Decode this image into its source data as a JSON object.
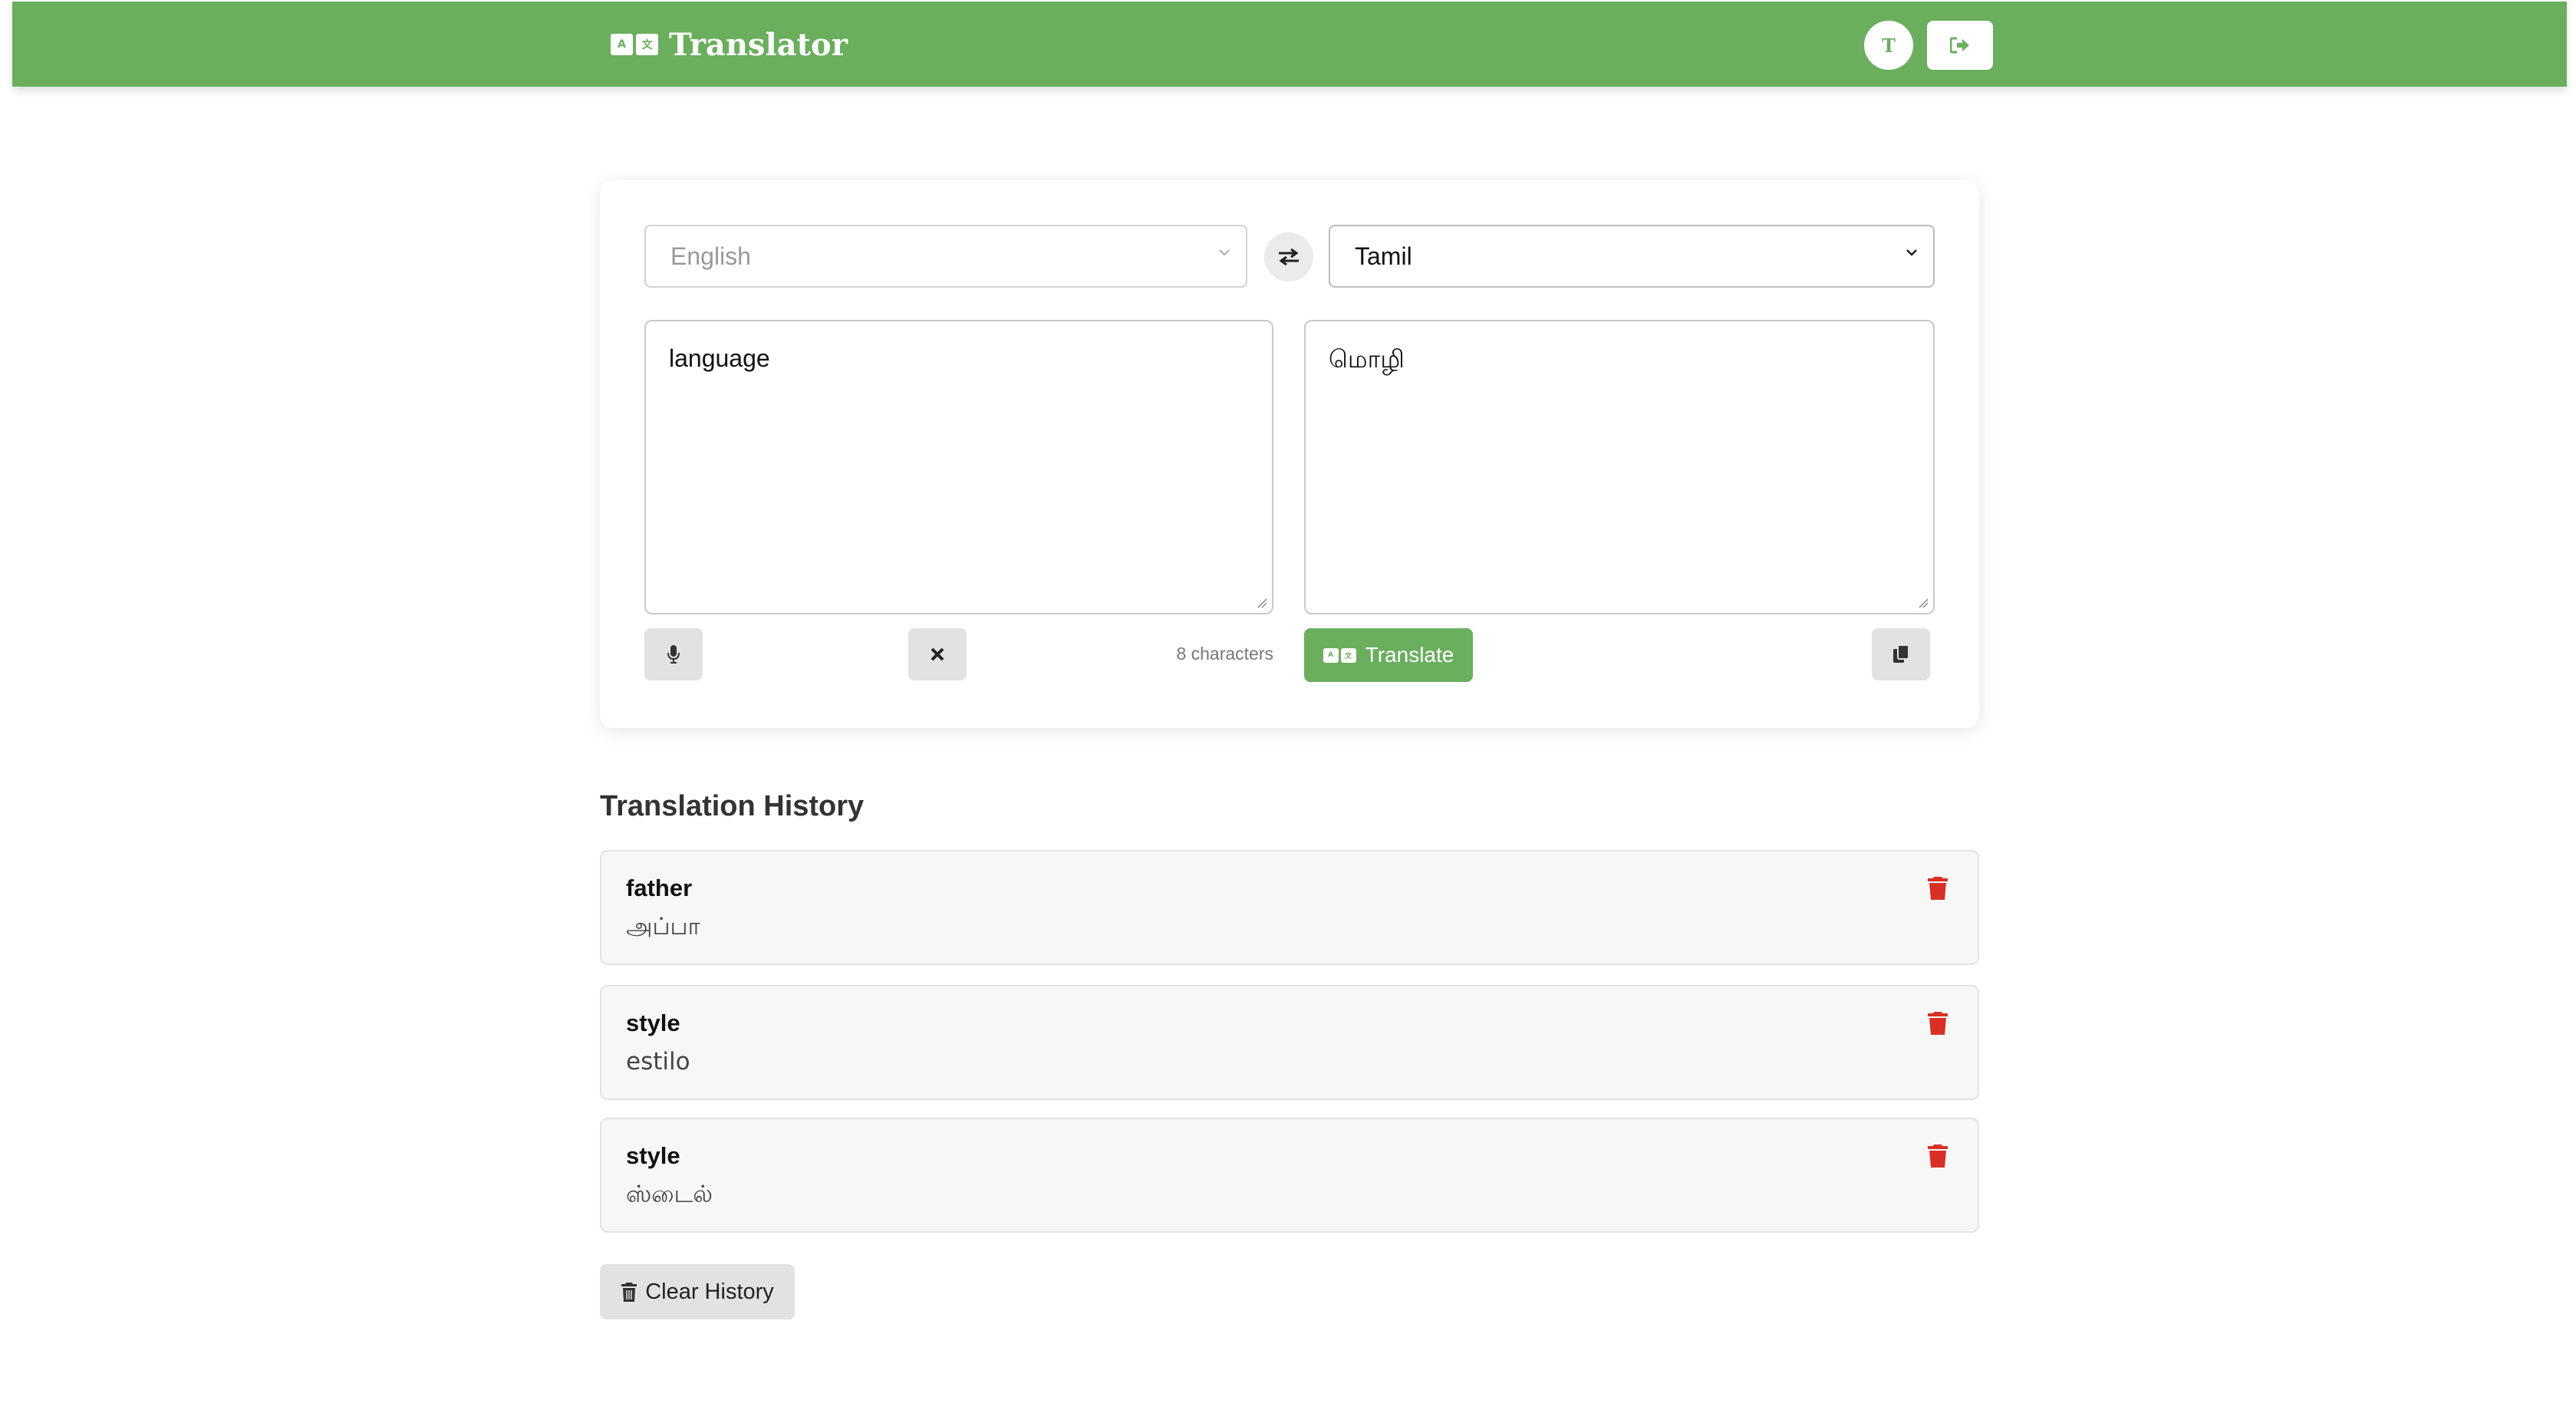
{
  "header": {
    "icon": "translate-icon",
    "title": "Translator",
    "avatar_initial": "T",
    "logout_icon": "sign-out-icon"
  },
  "translator": {
    "source_language": "English",
    "target_language": "Tamil",
    "swap_icon": "swap-arrows-icon",
    "source_text": "language",
    "translated_text": "மொழி",
    "char_count": "8 characters",
    "translate_label": "Translate",
    "mic_icon": "microphone-icon",
    "clear_icon": "close-icon",
    "copy_icon": "copy-icon"
  },
  "history": {
    "title": "Translation History",
    "items": [
      {
        "source": "father",
        "translation": "அப்பா"
      },
      {
        "source": "style",
        "translation": "estilo"
      },
      {
        "source": "style",
        "translation": "ஸ்டைல்"
      }
    ],
    "clear_label": "Clear History"
  },
  "colors": {
    "accent": "#6aae5e",
    "danger": "#d93025"
  }
}
